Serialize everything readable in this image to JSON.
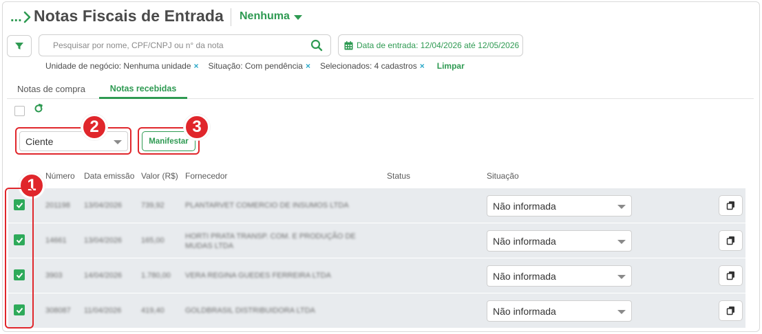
{
  "header": {
    "breadcrumb_ellipsis": "...",
    "title": "Notas Fiscais de Entrada",
    "company_selector": "Nenhuma"
  },
  "filters": {
    "search_placeholder": "Pesquisar por nome, CPF/CNPJ ou n° da nota",
    "date_filter": "Data de entrada: 12/04/2026 até 12/05/2026",
    "chips": [
      {
        "label": "Unidade de negócio: Nenhuma unidade"
      },
      {
        "label": "Situação: Com pendência"
      },
      {
        "label": "Selecionados: 4 cadastros"
      }
    ],
    "chip_remove": "×",
    "clear_label": "Limpar"
  },
  "tabs": [
    {
      "label": "Notas de compra",
      "active": false
    },
    {
      "label": "Notas recebidas",
      "active": true
    }
  ],
  "toolbar": {
    "manifest_select_value": "Ciente",
    "manifest_button": "Manifestar"
  },
  "annotations": [
    "1",
    "2",
    "3"
  ],
  "table": {
    "columns": [
      "Número",
      "Data emissão",
      "Valor (R$)",
      "Fornecedor",
      "Status",
      "Situação"
    ],
    "rows": [
      {
        "checked": true,
        "numero": "201198",
        "data": "13/04/2026",
        "valor": "739,92",
        "fornecedor": "PLANTARVET COMERCIO DE INSUMOS LTDA",
        "status": "",
        "situacao": "Não informada"
      },
      {
        "checked": true,
        "numero": "14661",
        "data": "13/04/2026",
        "valor": "165,00",
        "fornecedor": "HORTI PRATA TRANSP. COM. E PRODUÇÃO DE MUDAS LTDA",
        "status": "",
        "situacao": "Não informada"
      },
      {
        "checked": true,
        "numero": "3903",
        "data": "14/04/2026",
        "valor": "1.780,00",
        "fornecedor": "VERA REGINA GUEDES FERREIRA LTDA",
        "status": "",
        "situacao": "Não informada"
      },
      {
        "checked": true,
        "numero": "308087",
        "data": "11/04/2026",
        "valor": "419,40",
        "fornecedor": "GOLDBRASIL DISTRIBUIDORA LTDA",
        "status": "",
        "situacao": "Não informada"
      }
    ]
  },
  "colors": {
    "accent": "#2e9a52",
    "highlight": "#e0262b",
    "row_bg": "#e8ebee"
  }
}
